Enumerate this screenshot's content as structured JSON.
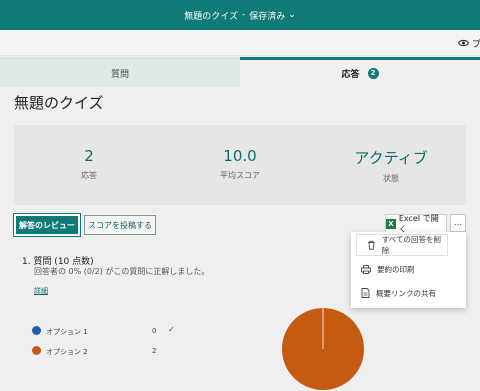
{
  "header": {
    "title": "無題のクイズ",
    "separator": "-",
    "save_state": "保存済み",
    "caret": "⌄"
  },
  "toolbar": {
    "preview_label": "プ"
  },
  "tabs": [
    {
      "label": "質問"
    },
    {
      "label": "応答",
      "badge": "2"
    }
  ],
  "page_title": "無題のクイズ",
  "stats": [
    {
      "value": "2",
      "label": "応答"
    },
    {
      "value": "10.0",
      "label": "平均スコア"
    },
    {
      "value": "アクティブ",
      "label": "状態"
    }
  ],
  "actions": {
    "review_label": "解答のレビュー",
    "post_scores_label": "スコアを投稿する",
    "excel_label": "Excel で開く",
    "excel_icon_text": "X",
    "more_label": "..."
  },
  "question": {
    "title": "1. 質問 (10 点数)",
    "summary": "回答者の 0% (0/2) がこの質問に正解しました。",
    "detail_link": "詳細"
  },
  "legend": [
    {
      "name": "オプション 1",
      "value": "0",
      "check": "✓",
      "color": "#1f5fa8"
    },
    {
      "name": "オプション 2",
      "value": "2",
      "check": "",
      "color": "#c55a11"
    }
  ],
  "chart_data": {
    "type": "pie",
    "categories": [
      "オプション 1",
      "オプション 2"
    ],
    "values": [
      0,
      2
    ],
    "colors": [
      "#1f5fa8",
      "#c55a11"
    ]
  },
  "menu": [
    {
      "label": "すべての回答を削除",
      "icon": "trash-icon"
    },
    {
      "label": "要約の印刷",
      "icon": "printer-icon"
    },
    {
      "label": "概要リンクの共有",
      "icon": "document-icon"
    }
  ],
  "colors": {
    "brand": "#0f7a76",
    "orange": "#c55a11",
    "blue": "#1f5fa8"
  }
}
